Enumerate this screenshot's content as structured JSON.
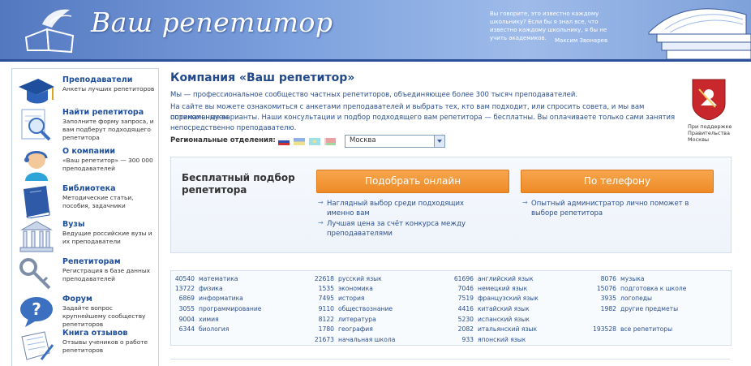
{
  "header": {
    "title": "Ваш репетитор",
    "quote": "Вы говорите, это известно каждому школьнику? Если бы я знал все, что известно каждому школьнику, я бы не учить академиков.",
    "quote_author": "Максим Звонарев",
    "background_color": "#7ea2de"
  },
  "sidebar": {
    "items": [
      {
        "title": "Преподаватели",
        "desc": "Анкеты лучших репетиторов",
        "icon": "graduation-cap-icon"
      },
      {
        "title": "Найти репетитора",
        "desc": "Заполните форму запроса, и вам подберут подходящего репетитора",
        "icon": "magnifier-icon"
      },
      {
        "title": "О компании",
        "desc": "«Ваш репетитор» — 300 000 преподавателей",
        "icon": "operator-icon"
      },
      {
        "title": "Библиотека",
        "desc": "Методические статьи, пособия, задачники",
        "icon": "book-icon"
      },
      {
        "title": "Вузы",
        "desc": "Ведущие российские вузы и их преподаватели",
        "icon": "university-icon"
      },
      {
        "title": "Репетиторам",
        "desc": "Регистрация в базе данных преподавателей",
        "icon": "key-icon"
      },
      {
        "title": "Форум",
        "desc": "Задайте вопрос крупнейшему сообществу репетиторов",
        "icon": "question-icon"
      },
      {
        "title": "Книга отзывов",
        "desc": "Отзывы учеников о работе репетиторов",
        "icon": "notebook-icon"
      }
    ]
  },
  "main": {
    "title": "Компания «Ваш репетитор»",
    "intro1": "Мы — профессиональное сообщество частных репетиторов, объединяющее более 300 тысяч преподавателей.",
    "intro2_line1": "На сайте вы можете ознакомиться с анкетами преподавателей и выбрать тех, кто вам подходит, или спросить совета, и мы вам порекомендуем",
    "intro2_line2": "оптимальные варианты. Наши консультации и подбор подходящего вам репетитора — бесплатны. Вы оплачиваете только сами занятия",
    "intro2_line3": "непосредственно преподавателю.",
    "regional_label": "Региональные отделения:",
    "city": "Москва",
    "coat_caption": "При поддержке Правительства Москвы"
  },
  "panel": {
    "title": "Бесплатный подбор репетитора",
    "btn_online": "Подобрать онлайн",
    "btn_phone": "По телефону",
    "online_b1_l1": "Наглядный выбор среди подходящих",
    "online_b1_l2": "именно вам",
    "online_b2_l1": "Лучшая цена за счёт конкурса между",
    "online_b2_l2": "преподавателями",
    "phone_b1_l1": "Опытный администратор лично поможет в",
    "phone_b1_l2": "выборе репетитора",
    "accent_color": "#ee8a26"
  },
  "subjects": {
    "col1": [
      {
        "n": "40540",
        "s": "математика"
      },
      {
        "n": "13722",
        "s": "физика"
      },
      {
        "n": "6869",
        "s": "информатика"
      },
      {
        "n": "3055",
        "s": "программирование"
      },
      {
        "n": "9004",
        "s": "химия"
      },
      {
        "n": "6344",
        "s": "биология"
      }
    ],
    "col2": [
      {
        "n": "22618",
        "s": "русский язык"
      },
      {
        "n": "1535",
        "s": "экономика"
      },
      {
        "n": "7495",
        "s": "история"
      },
      {
        "n": "9110",
        "s": "обществознание"
      },
      {
        "n": "8122",
        "s": "литература"
      },
      {
        "n": "1780",
        "s": "география"
      },
      {
        "n": "21673",
        "s": "начальная школа"
      }
    ],
    "col3": [
      {
        "n": "61696",
        "s": "английский язык"
      },
      {
        "n": "7046",
        "s": "немецкий язык"
      },
      {
        "n": "7519",
        "s": "французский язык"
      },
      {
        "n": "4416",
        "s": "китайский язык"
      },
      {
        "n": "5230",
        "s": "испанский язык"
      },
      {
        "n": "2082",
        "s": "итальянский язык"
      },
      {
        "n": "933",
        "s": "японский язык"
      }
    ],
    "col4": [
      {
        "n": "8076",
        "s": "музыка"
      },
      {
        "n": "15076",
        "s": "подготовка к школе"
      },
      {
        "n": "3935",
        "s": "логопеды"
      },
      {
        "n": "1982",
        "s": "другие предметы"
      },
      {
        "n": "",
        "s": ""
      },
      {
        "n": "193528",
        "s": "все репетиторы"
      }
    ]
  }
}
